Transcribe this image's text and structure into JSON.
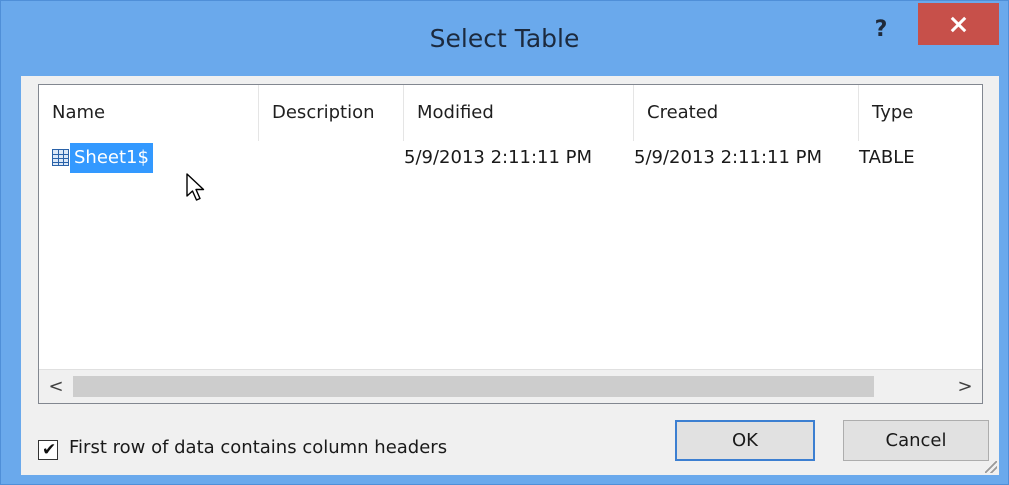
{
  "window": {
    "title": "Select Table",
    "help_label": "?",
    "close_icon": "close-icon"
  },
  "table": {
    "columns": [
      "Name",
      "Description",
      "Modified",
      "Created",
      "Type"
    ],
    "rows": [
      {
        "name": "Sheet1$",
        "description": "",
        "modified": "5/9/2013 2:11:11 PM",
        "created": "5/9/2013 2:11:11 PM",
        "type": "TABLE",
        "icon": "table-icon",
        "selected": true
      }
    ]
  },
  "scrollbar": {
    "left_arrow": "<",
    "right_arrow": ">"
  },
  "options": {
    "first_row_headers_label": "First row of data contains column headers",
    "first_row_headers_checked": true,
    "check_mark": "✔"
  },
  "buttons": {
    "ok": "OK",
    "cancel": "Cancel"
  },
  "colors": {
    "titlebar": "#6aa9ec",
    "close": "#c7504a",
    "selection": "#3399ff"
  }
}
